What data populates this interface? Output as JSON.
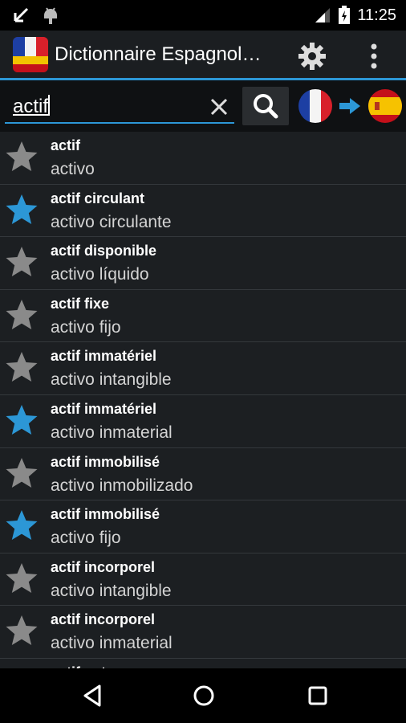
{
  "status_bar": {
    "time": "11:25",
    "icons": [
      "missed-call-arrow-icon",
      "android-debug-icon",
      "signal-icon",
      "battery-icon"
    ]
  },
  "app_bar": {
    "title": "Dictionnaire Espagnol…",
    "icons": [
      "app-flag-icon",
      "gear-icon",
      "overflow-menu-icon"
    ]
  },
  "search": {
    "value": "actif",
    "icons": [
      "clear-icon",
      "search-icon"
    ],
    "source_language_flag": "france-flag-icon",
    "direction_icon": "arrow-right-icon",
    "target_language_flag": "spain-flag-icon"
  },
  "colors": {
    "accent": "#2c97d6",
    "star_favorite": "#2c97d6",
    "star_default": "#8a8a8a",
    "row_bg": "#1c1f22",
    "appbar_bg": "#1b1e21"
  },
  "entries": [
    {
      "word": "actif",
      "translation": "activo",
      "favorite": false
    },
    {
      "word": "actif circulant",
      "translation": "activo circulante",
      "favorite": true
    },
    {
      "word": "actif disponible",
      "translation": "activo líquido",
      "favorite": false
    },
    {
      "word": "actif fixe",
      "translation": "activo fijo",
      "favorite": false
    },
    {
      "word": "actif immatériel",
      "translation": "activo intangible",
      "favorite": false
    },
    {
      "word": "actif immatériel",
      "translation": "activo inmaterial",
      "favorite": true
    },
    {
      "word": "actif immobilisé",
      "translation": "activo inmobilizado",
      "favorite": false
    },
    {
      "word": "actif immobilisé",
      "translation": "activo fijo",
      "favorite": true
    },
    {
      "word": "actif incorporel",
      "translation": "activo intangible",
      "favorite": false
    },
    {
      "word": "actif incorporel",
      "translation": "activo inmaterial",
      "favorite": false
    },
    {
      "word": "actif net",
      "translation": "",
      "favorite": false
    }
  ],
  "nav_bar": {
    "icons": [
      "back-icon",
      "home-icon",
      "recent-apps-icon"
    ]
  }
}
